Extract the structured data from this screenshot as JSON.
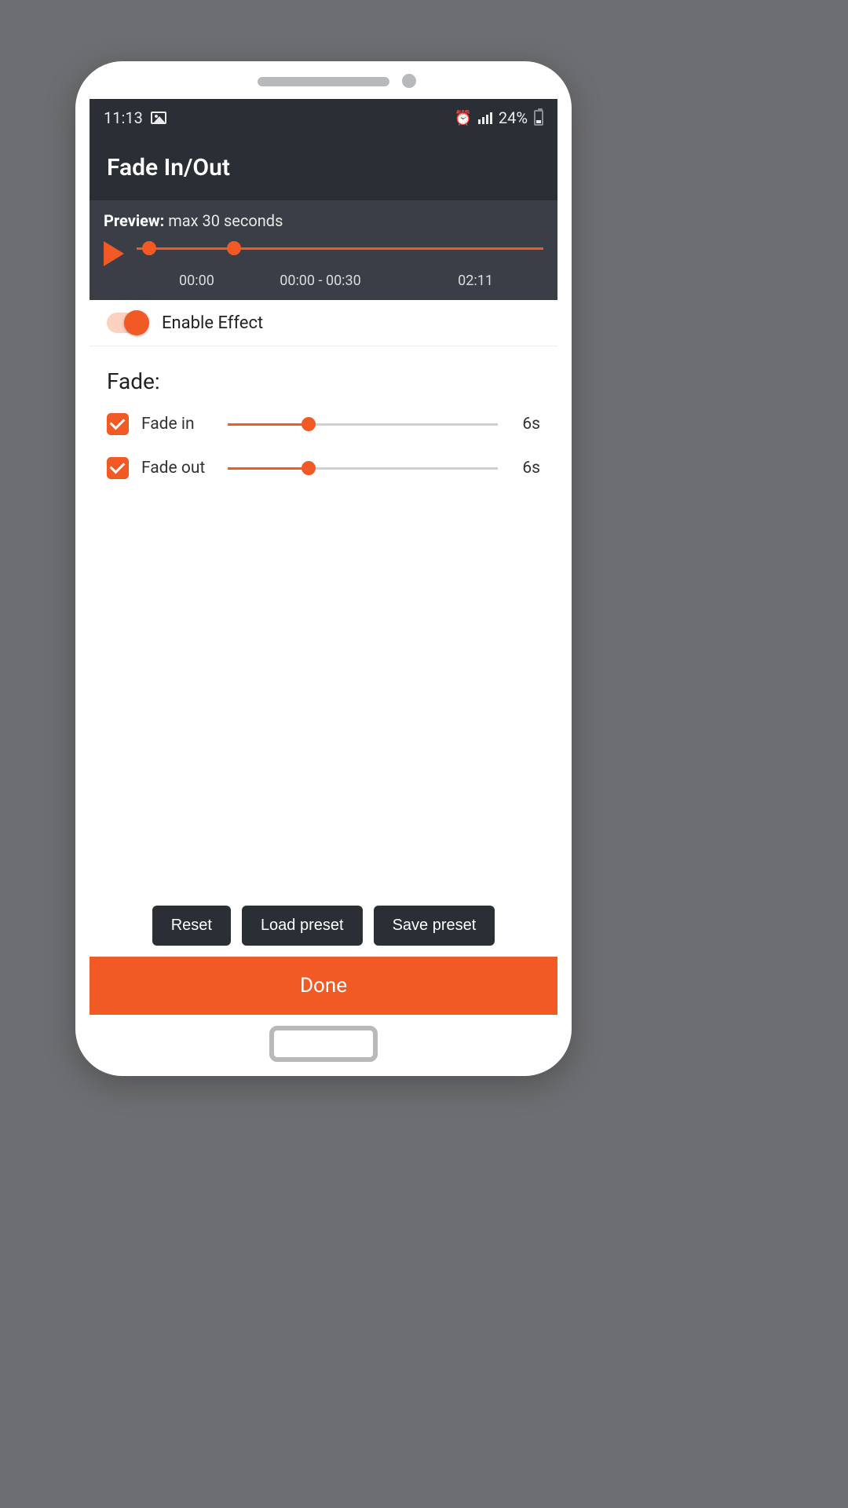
{
  "status": {
    "time": "11:13",
    "battery": "24%"
  },
  "header": {
    "title": "Fade In/Out"
  },
  "preview": {
    "label_prefix": "Preview:",
    "label_text": "max 30 seconds",
    "time_start": "00:00",
    "time_range": "00:00 - 00:30",
    "time_end": "02:11"
  },
  "enable": {
    "label": "Enable Effect"
  },
  "fade": {
    "heading": "Fade:",
    "rows": [
      {
        "label": "Fade in",
        "value": "6s"
      },
      {
        "label": "Fade out",
        "value": "6s"
      }
    ]
  },
  "buttons": {
    "reset": "Reset",
    "load": "Load preset",
    "save": "Save preset",
    "done": "Done"
  }
}
